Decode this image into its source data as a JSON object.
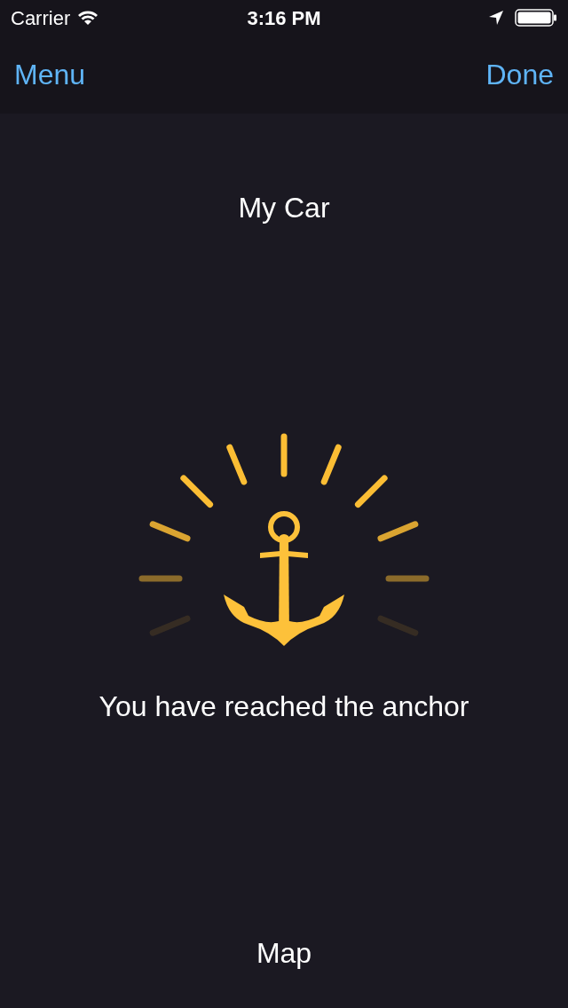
{
  "status_bar": {
    "carrier": "Carrier",
    "time": "3:16 PM"
  },
  "nav_bar": {
    "left_button": "Menu",
    "right_button": "Done"
  },
  "title": "My Car",
  "message": "You have reached the anchor",
  "bottom_button": "Map"
}
